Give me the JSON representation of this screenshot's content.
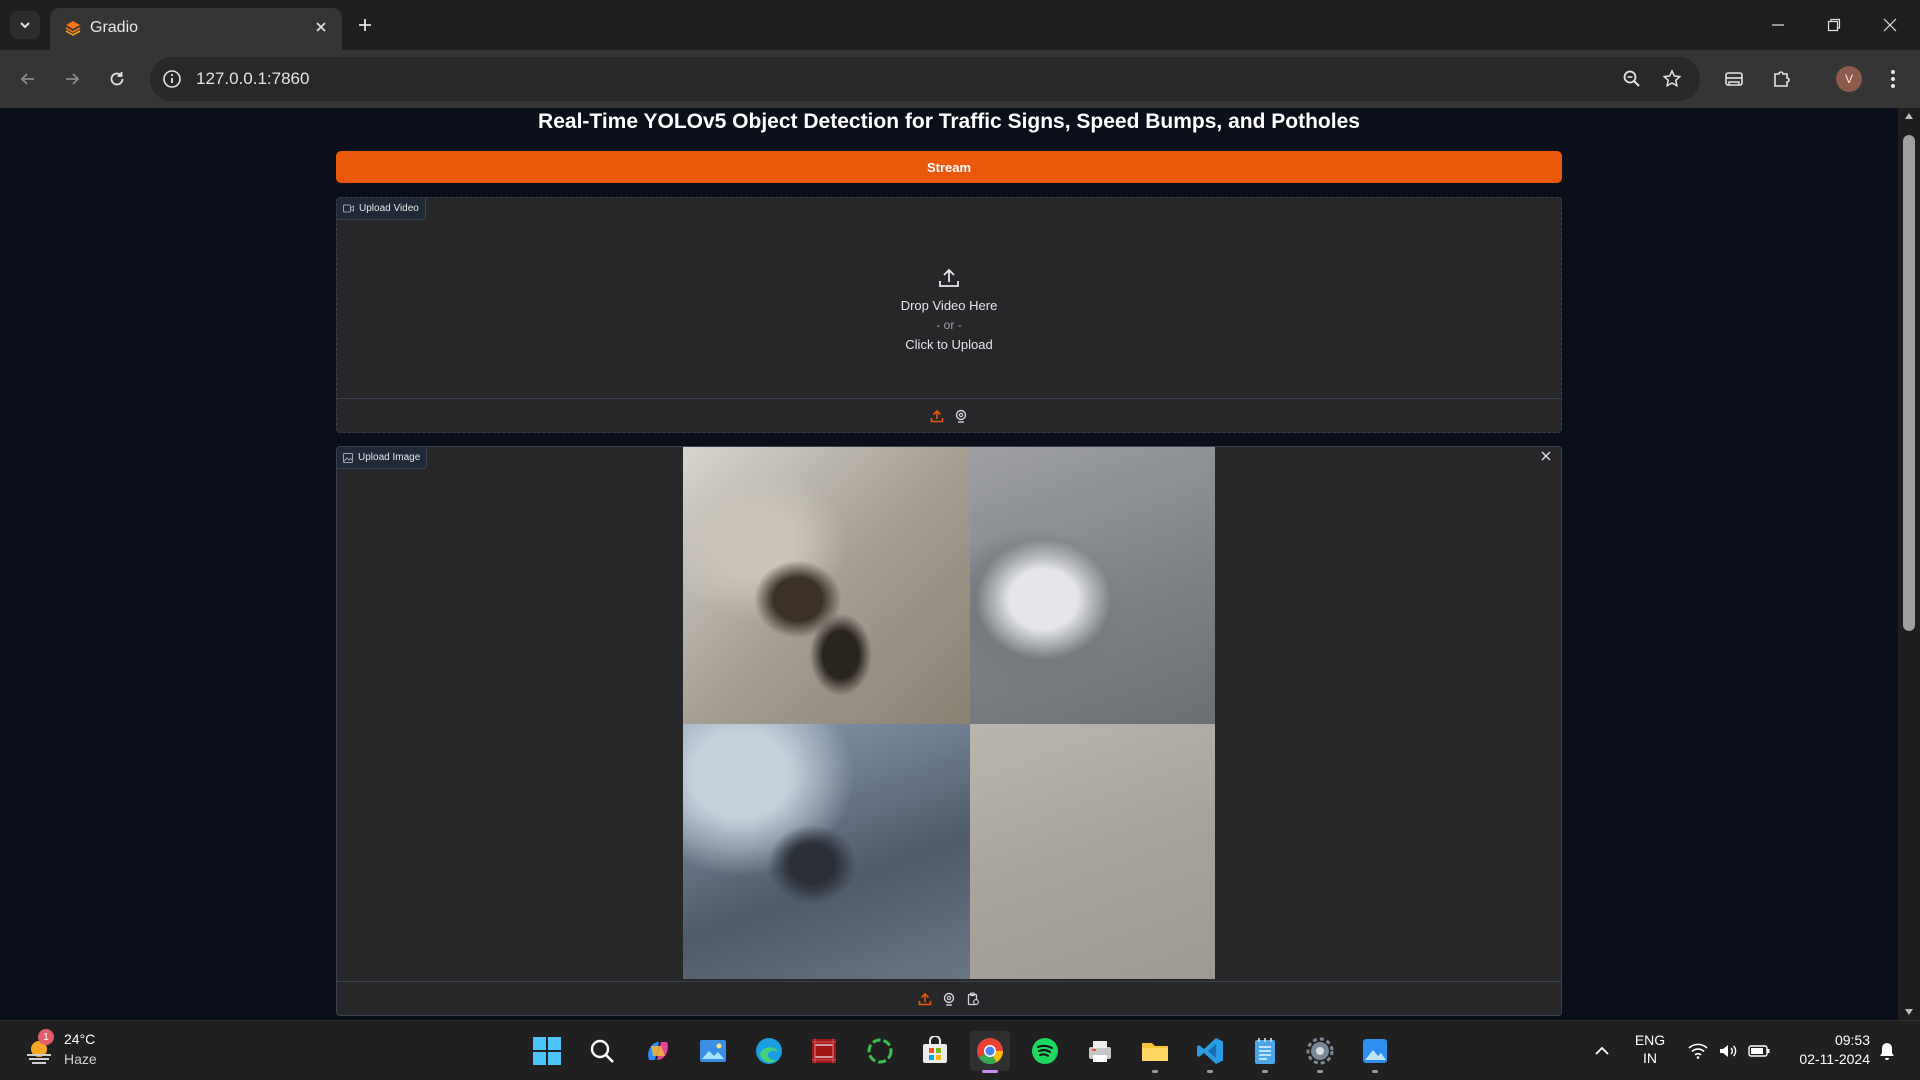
{
  "browser": {
    "tab_title": "Gradio",
    "url": "127.0.0.1:7860"
  },
  "page": {
    "title": "Real-Time YOLOv5 Object Detection for Traffic Signs, Speed Bumps, and Potholes",
    "stream_label": "Stream",
    "video_panel": {
      "label": "Upload Video",
      "drop_text": "Drop Video Here",
      "or_text": "- or -",
      "click_text": "Click to Upload"
    },
    "image_panel": {
      "label": "Upload Image"
    }
  },
  "taskbar": {
    "weather": {
      "temp": "24°C",
      "condition": "Haze",
      "badge": "1"
    },
    "language": {
      "line1": "ENG",
      "line2": "IN"
    },
    "clock": {
      "time": "09:53",
      "date": "02-11-2024"
    }
  },
  "colors": {
    "accent": "#ea580c",
    "page_bg": "#0b0f19",
    "panel_bg": "#27272a"
  }
}
